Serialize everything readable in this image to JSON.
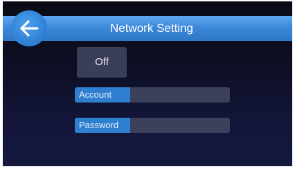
{
  "header": {
    "title": "Network Setting"
  },
  "network_toggle": {
    "label": "Off"
  },
  "account_field": {
    "label": "Account",
    "value": ""
  },
  "password_field": {
    "label": "Password",
    "value": ""
  },
  "icons": {
    "back": "arrow-left-icon"
  },
  "colors": {
    "accent": "#3a86d8",
    "background": "#0d0f24",
    "button": "#3b3e58"
  }
}
